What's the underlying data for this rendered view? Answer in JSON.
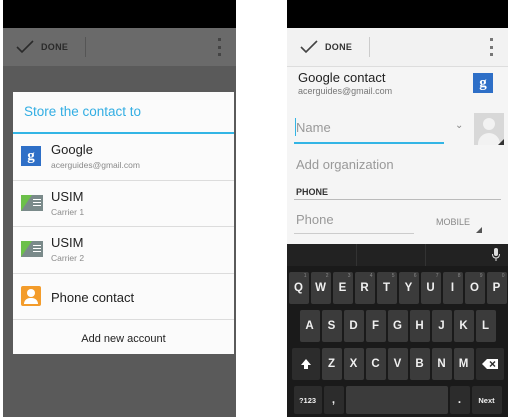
{
  "left_screen": {
    "done_label": "DONE",
    "dialog_title": "Store the contact to",
    "accounts": [
      {
        "name": "Google",
        "sub": "acerguides@gmail.com",
        "icon": "google-g-icon"
      },
      {
        "name": "USIM",
        "sub": "Carrier 1",
        "icon": "sim-card-icon"
      },
      {
        "name": "USIM",
        "sub": "Carrier 2",
        "icon": "sim-card-icon"
      },
      {
        "name": "Phone contact",
        "icon": "contact-icon"
      }
    ],
    "add_account_label": "Add new account",
    "google_glyph": "g"
  },
  "right_screen": {
    "done_label": "DONE",
    "account_title": "Google contact",
    "account_email": "acerguides@gmail.com",
    "google_glyph": "g",
    "name_placeholder": "Name",
    "organization_label": "Add organization",
    "phone_section": "PHONE",
    "phone_placeholder": "Phone",
    "phone_type": "MOBILE",
    "keyboard": {
      "row1": [
        "Q",
        "W",
        "E",
        "R",
        "T",
        "Y",
        "U",
        "I",
        "O",
        "P"
      ],
      "row1_hints": [
        "1",
        "2",
        "3",
        "4",
        "5",
        "6",
        "7",
        "8",
        "9",
        "0"
      ],
      "row2": [
        "A",
        "S",
        "D",
        "F",
        "G",
        "H",
        "J",
        "K",
        "L"
      ],
      "row3": [
        "Z",
        "X",
        "C",
        "V",
        "B",
        "N",
        "M"
      ],
      "symbols_key": "?123",
      "comma_key": ",",
      "period_key": ".",
      "next_key": "Next"
    }
  },
  "colors": {
    "accent": "#33b5e5",
    "google_blue": "#2e6fc7",
    "sim_green": "#6cc04a",
    "contact_orange": "#f39c2b"
  }
}
